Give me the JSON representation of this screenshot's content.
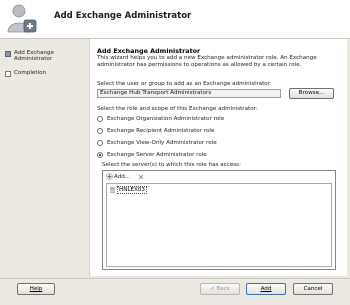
{
  "header": {
    "title": "Add Exchange Administrator"
  },
  "sidebar": {
    "steps": [
      {
        "label": "Add Exchange Administrator",
        "active": true
      },
      {
        "label": "Completion",
        "active": false
      }
    ]
  },
  "main": {
    "title": "Add Exchange Administrator",
    "description": "This wizard helps you to add a new Exchange administrator role.  An Exchange administrator has permissions to operations as allowed by a certain role.",
    "user_label": "Select the user or group to add as an Exchange administrator:",
    "user_value": "Exchange Hub Transport Administrators",
    "browse_label": "Browse...",
    "role_label": "Select the role and scope of this Exchange administrator:",
    "roles": [
      {
        "label": "Exchange Organization Administrator role",
        "checked": false
      },
      {
        "label": "Exchange Recipient Administrator role",
        "checked": false
      },
      {
        "label": "Exchange View-Only Administrator role",
        "checked": false
      },
      {
        "label": "Exchange Server Administrator role",
        "checked": true
      }
    ],
    "servers_label": "Select the server(s) to which this role has access:",
    "add_label": "Add...",
    "servers": [
      "HNLEX03"
    ]
  },
  "footer": {
    "help_label": "Help",
    "back_label": "< Back",
    "add_label": "Add",
    "cancel_label": "Cancel"
  }
}
